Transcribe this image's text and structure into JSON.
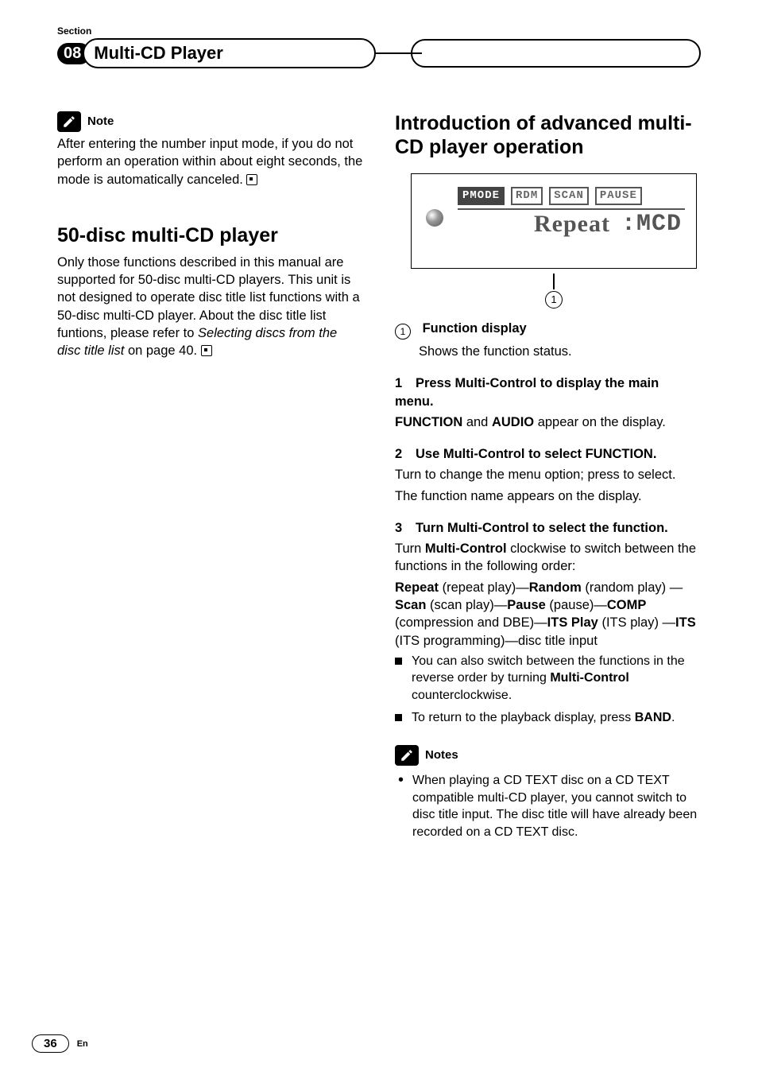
{
  "header": {
    "section_label": "Section",
    "chapter_number": "08",
    "chapter_title": "Multi-CD Player"
  },
  "left": {
    "note_label": "Note",
    "note_body": "After entering the number input mode, if you do not perform an operation within about eight seconds, the mode is automatically canceled.",
    "h2": "50-disc multi-CD player",
    "p1": "Only those functions described in this manual are supported for 50-disc multi-CD players. This unit is not designed to operate disc title list functions with a 50-disc multi-CD player. About the disc title list funtions, please refer to ",
    "p1_italic": "Selecting discs from the disc title list",
    "p1_tail": " on page 40."
  },
  "right": {
    "h2": "Introduction of advanced multi-CD player operation",
    "display": {
      "tags": {
        "pmode": "PMODE",
        "rdm": "RDM",
        "scan": "SCAN",
        "pause": "PAUSE"
      },
      "main_left": "Repeat",
      "main_right": ":MCD"
    },
    "callout_num": "1",
    "fn_label": "Function display",
    "fn_desc": "Shows the function status.",
    "step1_head": "Press Multi-Control to display the main menu.",
    "step1_body_a": "FUNCTION",
    "step1_body_mid": " and ",
    "step1_body_b": "AUDIO",
    "step1_body_tail": " appear on the display.",
    "step2_head": "Use Multi-Control to select FUNCTION.",
    "step2_l1": "Turn to change the menu option; press to select.",
    "step2_l2": "The function name appears on the display.",
    "step3_head": "Turn Multi-Control to select the function.",
    "step3_l1a": "Turn ",
    "step3_l1b": "Multi-Control",
    "step3_l1c": " clockwise to switch between the functions in the following order:",
    "seq": {
      "repeat": "Repeat",
      "repeat_p": " (repeat play)—",
      "random": "Random",
      "random_p": " (random play) —",
      "scan": "Scan",
      "scan_p": " (scan play)—",
      "pause": "Pause",
      "pause_p": " (pause)—",
      "comp": "COMP",
      "comp_p": " (compression and DBE)—",
      "itsplay": "ITS Play",
      "itsplay_p": " (ITS play) —",
      "its": "ITS",
      "its_p": " (ITS programming)—disc title input"
    },
    "b1_a": "You can also switch between the functions in the reverse order by turning ",
    "b1_b": "Multi-Control",
    "b1_c": " counterclockwise.",
    "b2_a": "To return to the playback display, press ",
    "b2_b": "BAND",
    "b2_c": ".",
    "notes_label": "Notes",
    "notes_item": "When playing a CD TEXT disc on a CD TEXT compatible multi-CD player, you cannot switch to disc title input. The disc title will have already been recorded on a CD TEXT disc."
  },
  "footer": {
    "page": "36",
    "lang": "En"
  }
}
